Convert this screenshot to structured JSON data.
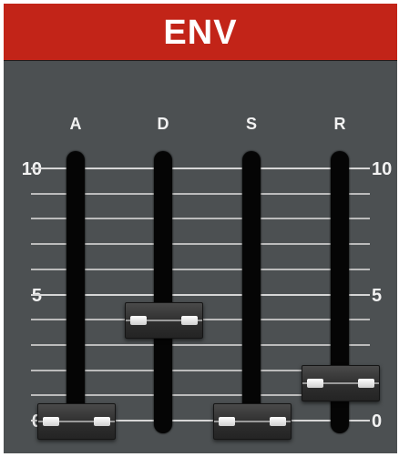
{
  "header": {
    "title": "ENV"
  },
  "scale": {
    "max_label": "10",
    "mid_label": "5",
    "min_label": "0"
  },
  "sliders": [
    {
      "label": "A",
      "value": 0
    },
    {
      "label": "D",
      "value": 4
    },
    {
      "label": "S",
      "value": 0
    },
    {
      "label": "R",
      "value": 1.5
    }
  ],
  "colors": {
    "header": "#c22418",
    "panel": "#4c5052",
    "track": "#050505"
  }
}
